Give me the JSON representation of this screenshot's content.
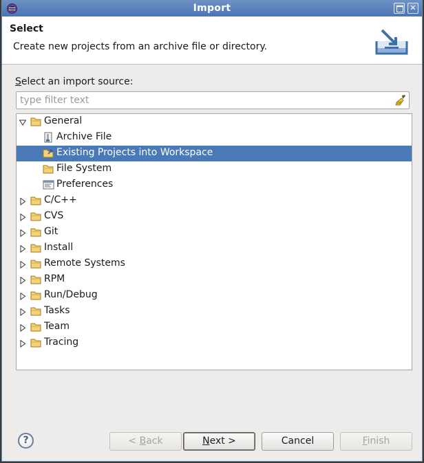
{
  "window": {
    "title": "Import"
  },
  "header": {
    "title": "Select",
    "description": "Create new projects from an archive file or directory."
  },
  "source": {
    "label_prefix": "S",
    "label_rest": "elect an import source:",
    "filter_placeholder": "type filter text",
    "filter_value": ""
  },
  "tree": {
    "items": [
      {
        "label": "General",
        "level": 0,
        "expanded": true,
        "icon": "folder-icon"
      },
      {
        "label": "Archive File",
        "level": 1,
        "icon": "archive-file-icon"
      },
      {
        "label": "Existing Projects into Workspace",
        "level": 1,
        "icon": "existing-projects-icon",
        "selected": true
      },
      {
        "label": "File System",
        "level": 1,
        "icon": "folder-icon"
      },
      {
        "label": "Preferences",
        "level": 1,
        "icon": "preferences-icon"
      },
      {
        "label": "C/C++",
        "level": 0,
        "expanded": false,
        "icon": "folder-icon"
      },
      {
        "label": "CVS",
        "level": 0,
        "expanded": false,
        "icon": "folder-icon"
      },
      {
        "label": "Git",
        "level": 0,
        "expanded": false,
        "icon": "folder-icon"
      },
      {
        "label": "Install",
        "level": 0,
        "expanded": false,
        "icon": "folder-icon"
      },
      {
        "label": "Remote Systems",
        "level": 0,
        "expanded": false,
        "icon": "folder-icon"
      },
      {
        "label": "RPM",
        "level": 0,
        "expanded": false,
        "icon": "folder-icon"
      },
      {
        "label": "Run/Debug",
        "level": 0,
        "expanded": false,
        "icon": "folder-icon"
      },
      {
        "label": "Tasks",
        "level": 0,
        "expanded": false,
        "icon": "folder-icon"
      },
      {
        "label": "Team",
        "level": 0,
        "expanded": false,
        "icon": "folder-icon"
      },
      {
        "label": "Tracing",
        "level": 0,
        "expanded": false,
        "icon": "folder-icon"
      }
    ]
  },
  "buttons": {
    "help": "?",
    "back_prefix": "< ",
    "back_mnemonic": "B",
    "back_rest": "ack",
    "next_mnemonic": "N",
    "next_rest": "ext >",
    "cancel": "Cancel",
    "finish_mnemonic": "F",
    "finish_rest": "inish"
  },
  "colors": {
    "selection": "#4a79b7",
    "titlebar": "#5a80bd"
  }
}
